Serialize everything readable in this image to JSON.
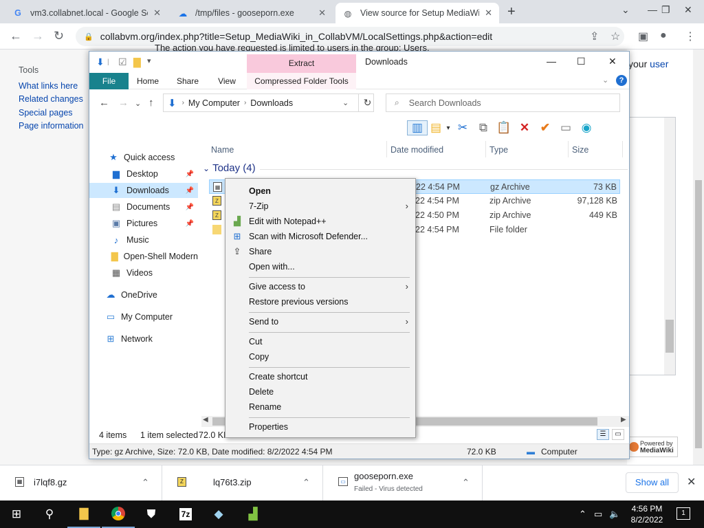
{
  "browser": {
    "tabs": [
      {
        "title": "vm3.collabnet.local - Google Sea",
        "icon": "google-icon"
      },
      {
        "title": "/tmp/files - gooseporn.exe",
        "icon": "cloud-icon"
      },
      {
        "title": "View source for Setup MediaWiki",
        "icon": "globe-icon"
      }
    ],
    "url": "collabvm.org/index.php?title=Setup_MediaWiki_in_CollabVM/LocalSettings.php&action=edit"
  },
  "wiki": {
    "notice_text": "The action you have requested is limited to users in the group: Users.",
    "your_text": "your",
    "user_link": "user",
    "tools_header": "Tools",
    "tools_links": [
      "What links here",
      "Related changes",
      "Special pages",
      "Page information"
    ],
    "badge_top": "Powered by",
    "badge_bottom": "MediaWiki"
  },
  "explorer": {
    "title": "Downloads",
    "extract_tab": "Extract",
    "ribbon_tabs": [
      "File",
      "Home",
      "Share",
      "View",
      "Compressed Folder Tools"
    ],
    "breadcrumb": [
      "My Computer",
      "Downloads"
    ],
    "search_placeholder": "Search Downloads",
    "columns": [
      "Name",
      "Date modified",
      "Type",
      "Size"
    ],
    "group_label": "Today (4)",
    "nav_items": [
      {
        "label": "Quick access",
        "icon": "star-icon"
      },
      {
        "label": "Desktop",
        "icon": "desktop-icon"
      },
      {
        "label": "Downloads",
        "icon": "download-arrow-icon"
      },
      {
        "label": "Documents",
        "icon": "document-icon"
      },
      {
        "label": "Pictures",
        "icon": "pictures-icon"
      },
      {
        "label": "Music",
        "icon": "music-icon"
      },
      {
        "label": "Open-Shell Modern",
        "icon": "folder-icon"
      },
      {
        "label": "Videos",
        "icon": "video-icon"
      },
      {
        "label": "OneDrive",
        "icon": "cloud-icon"
      },
      {
        "label": "My Computer",
        "icon": "computer-icon"
      },
      {
        "label": "Network",
        "icon": "network-icon"
      }
    ],
    "files": [
      {
        "date": "22 4:54 PM",
        "type": "gz Archive",
        "size": "73 KB"
      },
      {
        "date": "22 4:54 PM",
        "type": "zip Archive",
        "size": "97,128 KB"
      },
      {
        "date": "22 4:50 PM",
        "type": "zip Archive",
        "size": "449 KB"
      },
      {
        "date": "22 4:54 PM",
        "type": "File folder",
        "size": ""
      }
    ],
    "status_items": "4 items",
    "status_selected": "1 item selected",
    "status_size": "72.0 KB",
    "details_text": "Type: gz Archive, Size: 72.0 KB, Date modified: 8/2/2022 4:54 PM",
    "details_size": "72.0 KB",
    "details_location": "Computer"
  },
  "context_menu": {
    "open": "Open",
    "sevenzip": "7-Zip",
    "notepad": "Edit with Notepad++",
    "defender": "Scan with Microsoft Defender...",
    "share": "Share",
    "open_with": "Open with...",
    "give_access": "Give access to",
    "restore": "Restore previous versions",
    "send_to": "Send to",
    "cut": "Cut",
    "copy": "Copy",
    "create_shortcut": "Create shortcut",
    "delete": "Delete",
    "rename": "Rename",
    "properties": "Properties"
  },
  "downloads": [
    {
      "name": "i7lqf8.gz",
      "status": ""
    },
    {
      "name": "lq76t3.zip",
      "status": ""
    },
    {
      "name": "gooseporn.exe",
      "status": "Failed - Virus detected"
    }
  ],
  "downloads_show_all": "Show all",
  "taskbar": {
    "time": "4:56 PM",
    "date": "8/2/2022",
    "notification_count": "1"
  },
  "colors": {
    "accent": "#19828d",
    "selection": "#cce8ff",
    "extract_pink": "#f9c9dc",
    "link": "#0645ad"
  }
}
